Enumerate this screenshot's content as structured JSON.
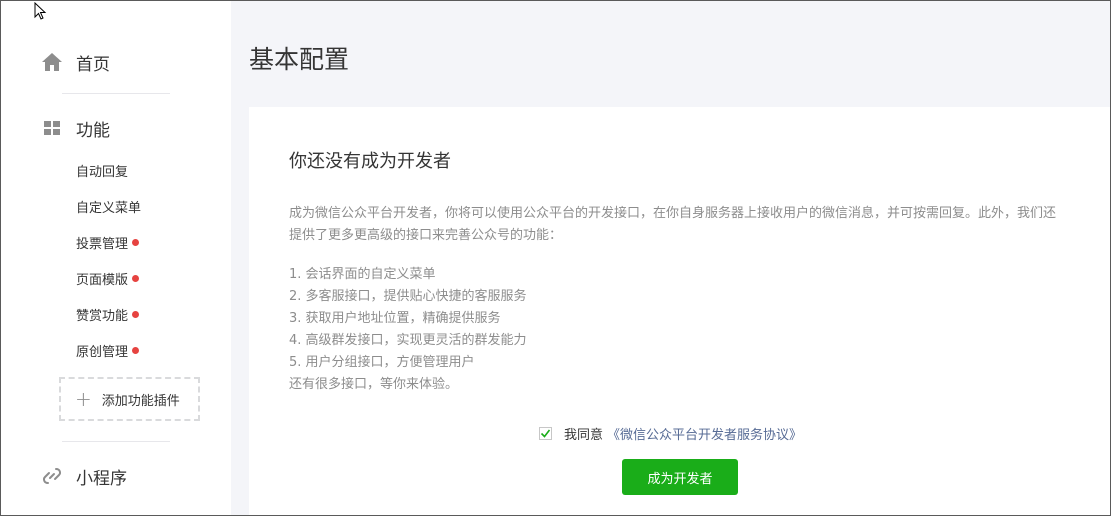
{
  "sidebar": {
    "home": {
      "label": "首页",
      "icon": "home-icon"
    },
    "features": {
      "label": "功能",
      "icon": "grid-icon",
      "items": [
        {
          "label": "自动回复",
          "badge": false
        },
        {
          "label": "自定义菜单",
          "badge": false
        },
        {
          "label": "投票管理",
          "badge": true
        },
        {
          "label": "页面模版",
          "badge": true
        },
        {
          "label": "赞赏功能",
          "badge": true
        },
        {
          "label": "原创管理",
          "badge": true
        }
      ],
      "add_plugin_label": "添加功能插件"
    },
    "mini_program": {
      "label": "小程序",
      "icon": "link-icon"
    }
  },
  "page": {
    "title": "基本配置"
  },
  "card": {
    "title": "你还没有成为开发者",
    "description": "成为微信公众平台开发者，你将可以使用公众平台的开发接口，在你自身服务器上接收用户的微信消息，并可按需回复。此外，我们还提供了更多更高级的接口来完善公众号的功能：",
    "features": [
      "1. 会话界面的自定义菜单",
      "2. 多客服接口，提供贴心快捷的客服服务",
      "3. 获取用户地址位置，精确提供服务",
      "4. 高级群发接口，实现更灵活的群发能力",
      "5. 用户分组接口，方便管理用户"
    ],
    "more_text": "还有很多接口，等你来体验。",
    "agree_label": "我同意",
    "agree_link": "《微信公众平台开发者服务协议》",
    "agree_checked": true,
    "button_label": "成为开发者"
  },
  "colors": {
    "accent_green": "#1aad19",
    "badge_red": "#e64340",
    "link_blue": "#576b95"
  }
}
